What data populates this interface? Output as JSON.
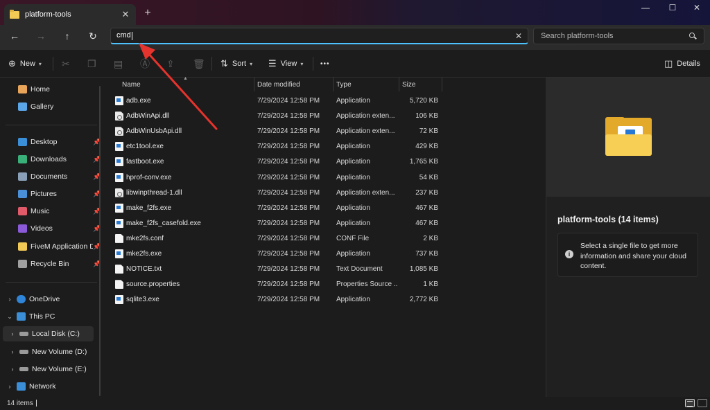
{
  "window": {
    "tab_title": "platform-tools",
    "tab_close": "✕",
    "new_tab": "+",
    "minimize": "—",
    "maximize": "☐",
    "close": "✕"
  },
  "address_bar": {
    "value": "cmd",
    "clear": "✕"
  },
  "search": {
    "placeholder": "Search platform-tools"
  },
  "toolbar": {
    "new_label": "New",
    "sort_label": "Sort",
    "view_label": "View",
    "more_label": "•••",
    "details_label": "Details"
  },
  "sidebar": {
    "items": [
      {
        "label": "Home",
        "color": "#e8a55a"
      },
      {
        "label": "Gallery",
        "color": "#5aa6e8"
      },
      {
        "label": "Desktop",
        "color": "#3b8fd9"
      },
      {
        "label": "Downloads",
        "color": "#39b07a"
      },
      {
        "label": "Documents",
        "color": "#8aa0b8"
      },
      {
        "label": "Pictures",
        "color": "#4a90d9"
      },
      {
        "label": "Music",
        "color": "#e05a6a"
      },
      {
        "label": "Videos",
        "color": "#8a5ad9"
      },
      {
        "label": "FiveM Application D",
        "color": "#f2c955"
      },
      {
        "label": "Recycle Bin",
        "color": "#a0a0a0"
      },
      {
        "label": "OneDrive",
        "color": "#2f86d9"
      },
      {
        "label": "This PC",
        "color": "#3b8fd9"
      },
      {
        "label": "Local Disk (C:)",
        "color": "#9a9a9a"
      },
      {
        "label": "New Volume (D:)",
        "color": "#9a9a9a"
      },
      {
        "label": "New Volume (E:)",
        "color": "#9a9a9a"
      },
      {
        "label": "Network",
        "color": "#3b8fd9"
      }
    ]
  },
  "columns": {
    "name": "Name",
    "date": "Date modified",
    "type": "Type",
    "size": "Size"
  },
  "files": [
    {
      "name": "adb.exe",
      "date": "7/29/2024 12:58 PM",
      "type": "Application",
      "size": "5,720 KB",
      "icon": "app"
    },
    {
      "name": "AdbWinApi.dll",
      "date": "7/29/2024 12:58 PM",
      "type": "Application exten...",
      "size": "106 KB",
      "icon": "dll"
    },
    {
      "name": "AdbWinUsbApi.dll",
      "date": "7/29/2024 12:58 PM",
      "type": "Application exten...",
      "size": "72 KB",
      "icon": "dll"
    },
    {
      "name": "etc1tool.exe",
      "date": "7/29/2024 12:58 PM",
      "type": "Application",
      "size": "429 KB",
      "icon": "app"
    },
    {
      "name": "fastboot.exe",
      "date": "7/29/2024 12:58 PM",
      "type": "Application",
      "size": "1,765 KB",
      "icon": "app"
    },
    {
      "name": "hprof-conv.exe",
      "date": "7/29/2024 12:58 PM",
      "type": "Application",
      "size": "54 KB",
      "icon": "app"
    },
    {
      "name": "libwinpthread-1.dll",
      "date": "7/29/2024 12:58 PM",
      "type": "Application exten...",
      "size": "237 KB",
      "icon": "dll"
    },
    {
      "name": "make_f2fs.exe",
      "date": "7/29/2024 12:58 PM",
      "type": "Application",
      "size": "467 KB",
      "icon": "app"
    },
    {
      "name": "make_f2fs_casefold.exe",
      "date": "7/29/2024 12:58 PM",
      "type": "Application",
      "size": "467 KB",
      "icon": "app"
    },
    {
      "name": "mke2fs.conf",
      "date": "7/29/2024 12:58 PM",
      "type": "CONF File",
      "size": "2 KB",
      "icon": "doc"
    },
    {
      "name": "mke2fs.exe",
      "date": "7/29/2024 12:58 PM",
      "type": "Application",
      "size": "737 KB",
      "icon": "app"
    },
    {
      "name": "NOTICE.txt",
      "date": "7/29/2024 12:58 PM",
      "type": "Text Document",
      "size": "1,085 KB",
      "icon": "doc"
    },
    {
      "name": "source.properties",
      "date": "7/29/2024 12:58 PM",
      "type": "Properties Source ...",
      "size": "1 KB",
      "icon": "doc"
    },
    {
      "name": "sqlite3.exe",
      "date": "7/29/2024 12:58 PM",
      "type": "Application",
      "size": "2,772 KB",
      "icon": "app"
    }
  ],
  "details_pane": {
    "title": "platform-tools (14 items)",
    "info": "Select a single file to get more information and share your cloud content."
  },
  "status": {
    "count": "14 items"
  },
  "colors": {
    "accent": "#4cc2ff",
    "annotation_arrow": "#e5332d"
  }
}
